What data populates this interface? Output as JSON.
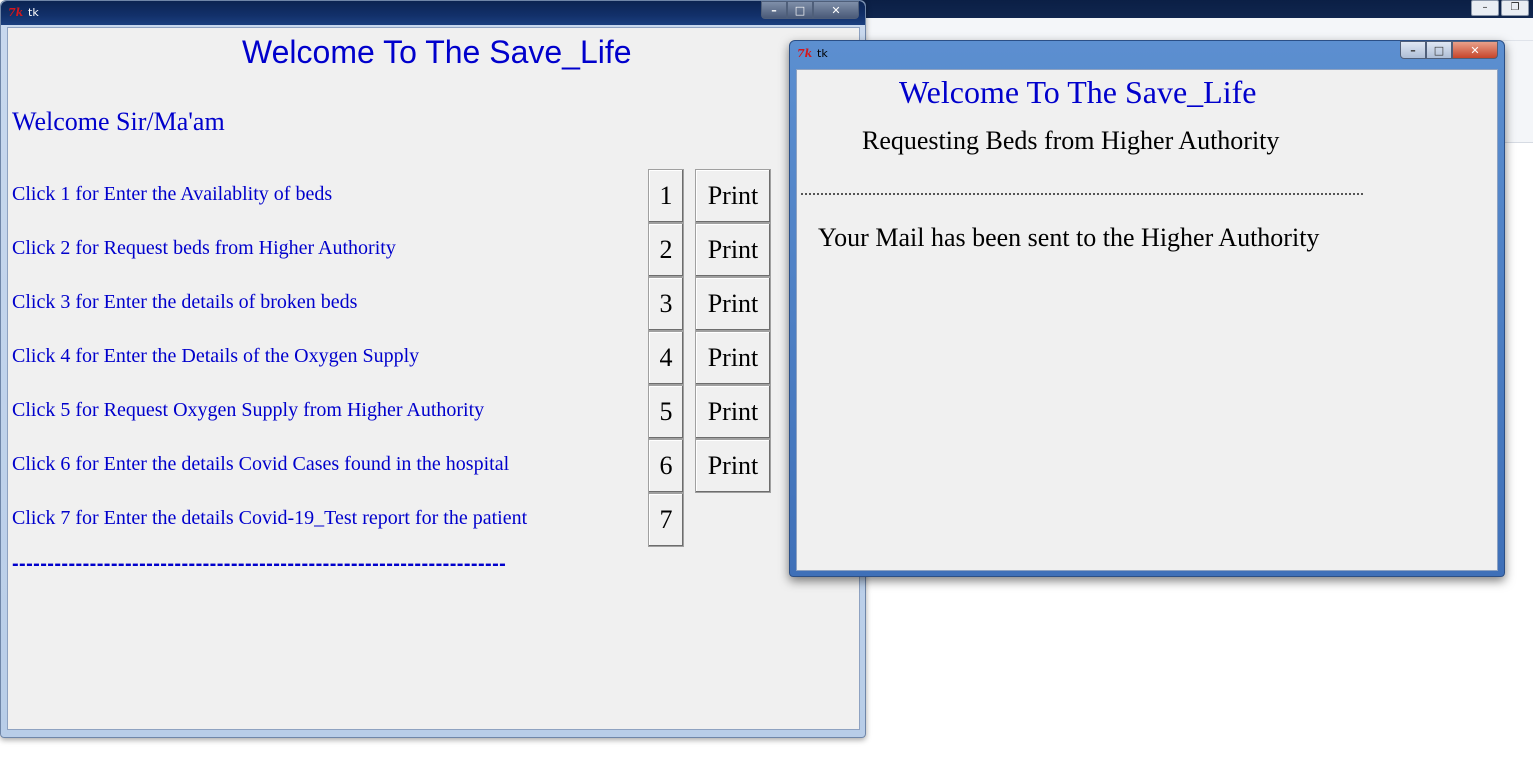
{
  "main_window": {
    "title": "tk",
    "heading": "Welcome To The Save_Life",
    "greeting": "Welcome Sir/Ma'am",
    "items": [
      {
        "label": "Click 1 for Enter the Availablity of beds",
        "button": "1",
        "print": "Print"
      },
      {
        "label": "Click 2 for Request beds from Higher Authority",
        "button": "2",
        "print": "Print"
      },
      {
        "label": "Click 3 for Enter the details of broken beds",
        "button": "3",
        "print": "Print"
      },
      {
        "label": "Click 4 for Enter the Details of the Oxygen Supply",
        "button": "4",
        "print": "Print"
      },
      {
        "label": "Click 5 for Request Oxygen Supply from Higher Authority",
        "button": "5",
        "print": "Print"
      },
      {
        "label": "Click 6 for Enter the details Covid Cases found in the hospital",
        "button": "6",
        "print": "Print"
      },
      {
        "label": "Click 7 for Enter the details Covid-19_Test report for the patient",
        "button": "7"
      }
    ],
    "separator": "----------------------------------------------------------------------"
  },
  "request_window": {
    "title": "tk",
    "heading": "Welcome To The Save_Life",
    "subheading": "Requesting  Beds from Higher Authority",
    "message": "Your Mail has been sent to the Higher Authority"
  },
  "window_controls": {
    "minimize": "–",
    "maximize": "□",
    "close": "✕"
  },
  "colors": {
    "accent_text": "#0000cc",
    "client_bg": "#f0f0f0"
  }
}
